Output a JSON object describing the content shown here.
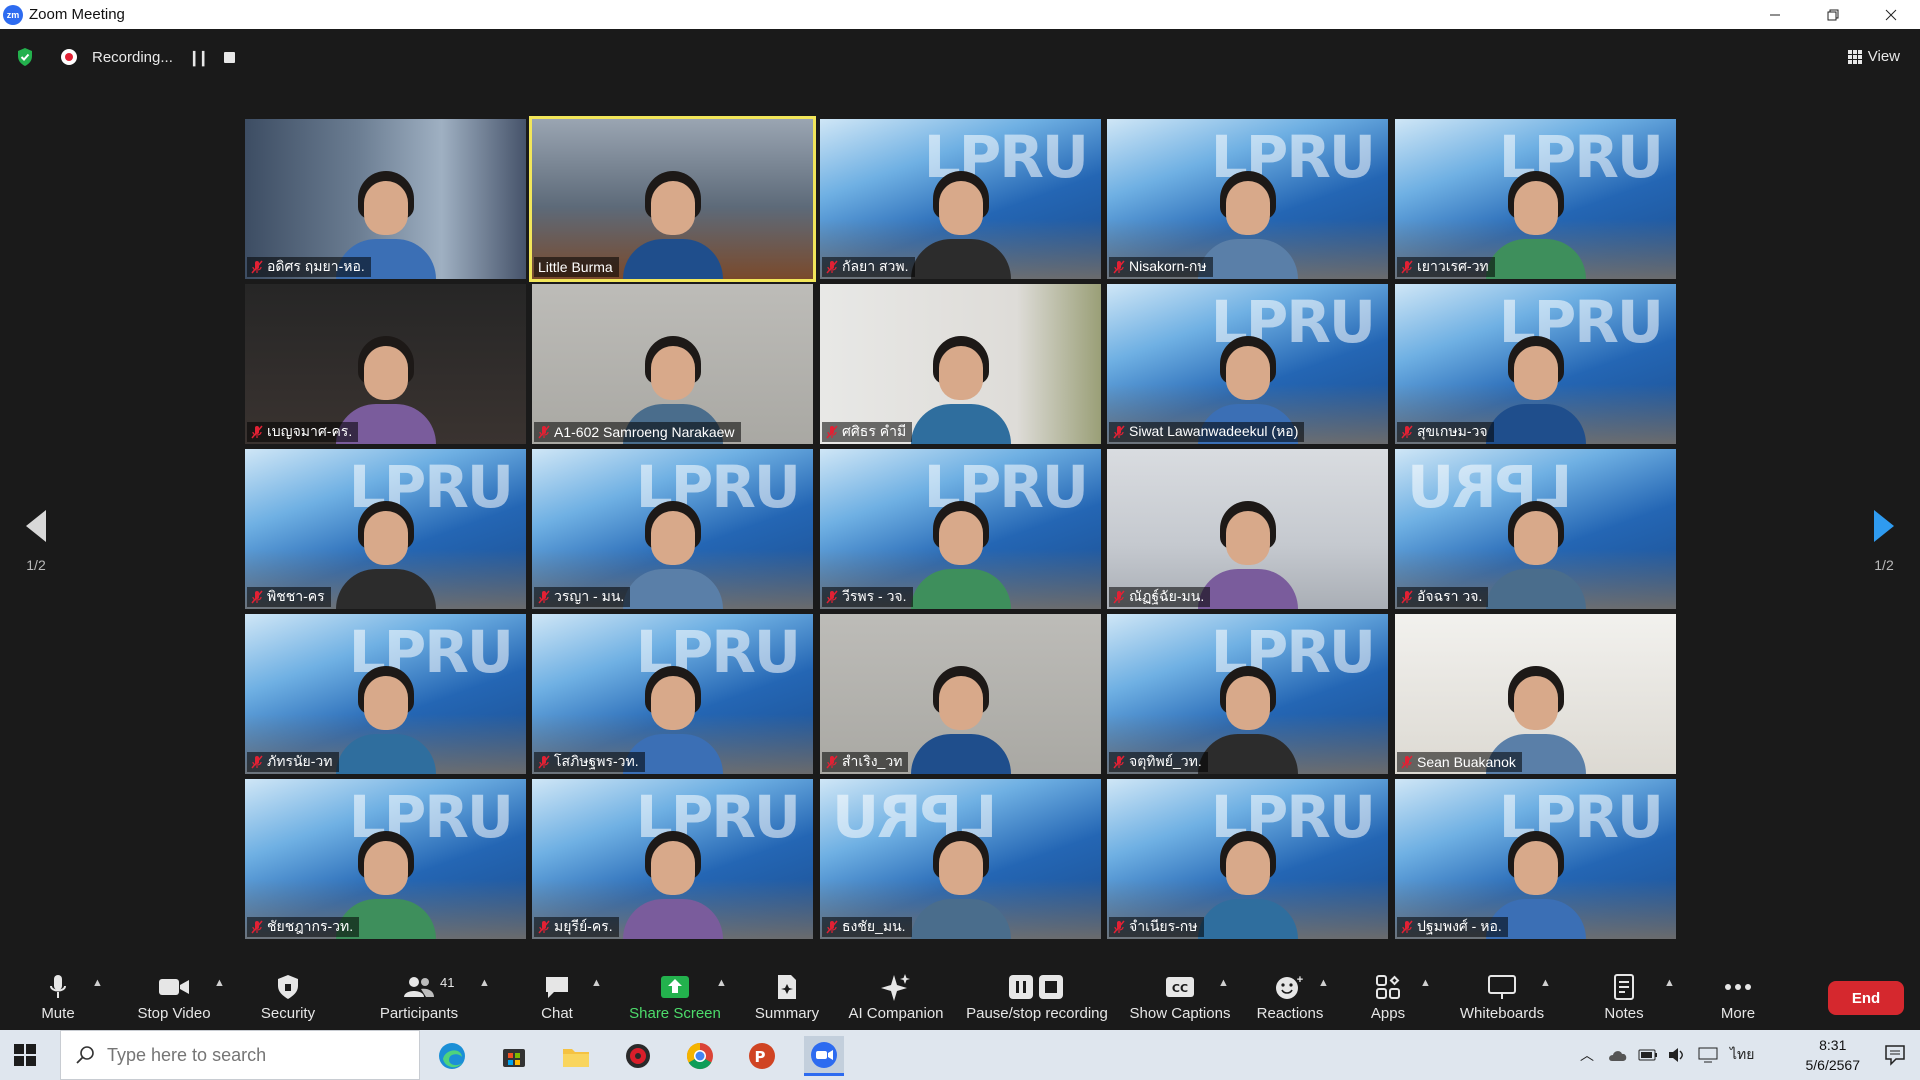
{
  "window": {
    "title": "Zoom Meeting",
    "app_icon_text": "zm"
  },
  "meeting": {
    "recording_label": "Recording...",
    "view_label": "View",
    "page_indicator_left": "1/2",
    "page_indicator_right": "1/2",
    "active_speaker_color": "#f2e65a"
  },
  "participants_grid": [
    {
      "name": "อดิศร ฤมยา-หอ.",
      "muted": true,
      "background": "shelf"
    },
    {
      "name": "Little Burma",
      "muted": false,
      "background": "office",
      "active": true
    },
    {
      "name": "กัลยา สวพ.",
      "muted": true,
      "background": "lpru"
    },
    {
      "name": "Nisakorn-กษ",
      "muted": true,
      "background": "lpru"
    },
    {
      "name": "เยาวเรศ-วท",
      "muted": true,
      "background": "lpru"
    },
    {
      "name": "เบญจมาศ-คร.",
      "muted": true,
      "background": "dark"
    },
    {
      "name": "A1-602 Samroeng Narakaew",
      "muted": true,
      "background": "grey"
    },
    {
      "name": "ศศิธร คำมี",
      "muted": true,
      "background": "curtain"
    },
    {
      "name": "Siwat Lawanwadeekul (หอ)",
      "muted": true,
      "background": "lpru"
    },
    {
      "name": "สุขเกษม-วจ",
      "muted": true,
      "background": "lpru"
    },
    {
      "name": "พิชชา-คร",
      "muted": true,
      "background": "lpru"
    },
    {
      "name": "วรญา - มน.",
      "muted": true,
      "background": "lpru"
    },
    {
      "name": "วีรพร - วจ.",
      "muted": true,
      "background": "lpru"
    },
    {
      "name": "ณัฏฐ์ฉัย-มน.",
      "muted": true,
      "background": "room"
    },
    {
      "name": "อัจฉรา วจ.",
      "muted": true,
      "background": "lpru-rev"
    },
    {
      "name": "ภัทรนัย-วท",
      "muted": true,
      "background": "lpru"
    },
    {
      "name": "โสภิษฐพร-วท.",
      "muted": true,
      "background": "lpru"
    },
    {
      "name": "สำเริง_วท",
      "muted": true,
      "background": "grey"
    },
    {
      "name": "จตุทิพย์_วท.",
      "muted": true,
      "background": "lpru"
    },
    {
      "name": "Sean Buakanok",
      "muted": true,
      "background": "white"
    },
    {
      "name": "ชัยชฎากร-วท.",
      "muted": true,
      "background": "lpru"
    },
    {
      "name": "มยุรีย์-คร.",
      "muted": true,
      "background": "lpru"
    },
    {
      "name": "ธงชัย_มน.",
      "muted": true,
      "background": "lpru-rev"
    },
    {
      "name": "จำเนียร-กษ",
      "muted": true,
      "background": "lpru"
    },
    {
      "name": "ปฐมพงศ์ - หอ.",
      "muted": true,
      "background": "lpru"
    }
  ],
  "toolbar": {
    "mute": "Mute",
    "stop_video": "Stop Video",
    "security": "Security",
    "participants": "Participants",
    "participants_count": "41",
    "chat": "Chat",
    "share_screen": "Share Screen",
    "summary": "Summary",
    "ai_companion": "AI Companion",
    "pause_stop_recording": "Pause/stop recording",
    "show_captions": "Show Captions",
    "reactions": "Reactions",
    "apps": "Apps",
    "whiteboards": "Whiteboards",
    "notes": "Notes",
    "more": "More",
    "end": "End"
  },
  "taskbar": {
    "search_placeholder": "Type here to search",
    "language": "ไทย",
    "time": "8:31",
    "date": "5/6/2567"
  },
  "colors": {
    "share_green": "#4ddc6b",
    "end_red": "#d5282e",
    "recording_red": "#e22134",
    "nav_blue": "#2f9bf0"
  }
}
